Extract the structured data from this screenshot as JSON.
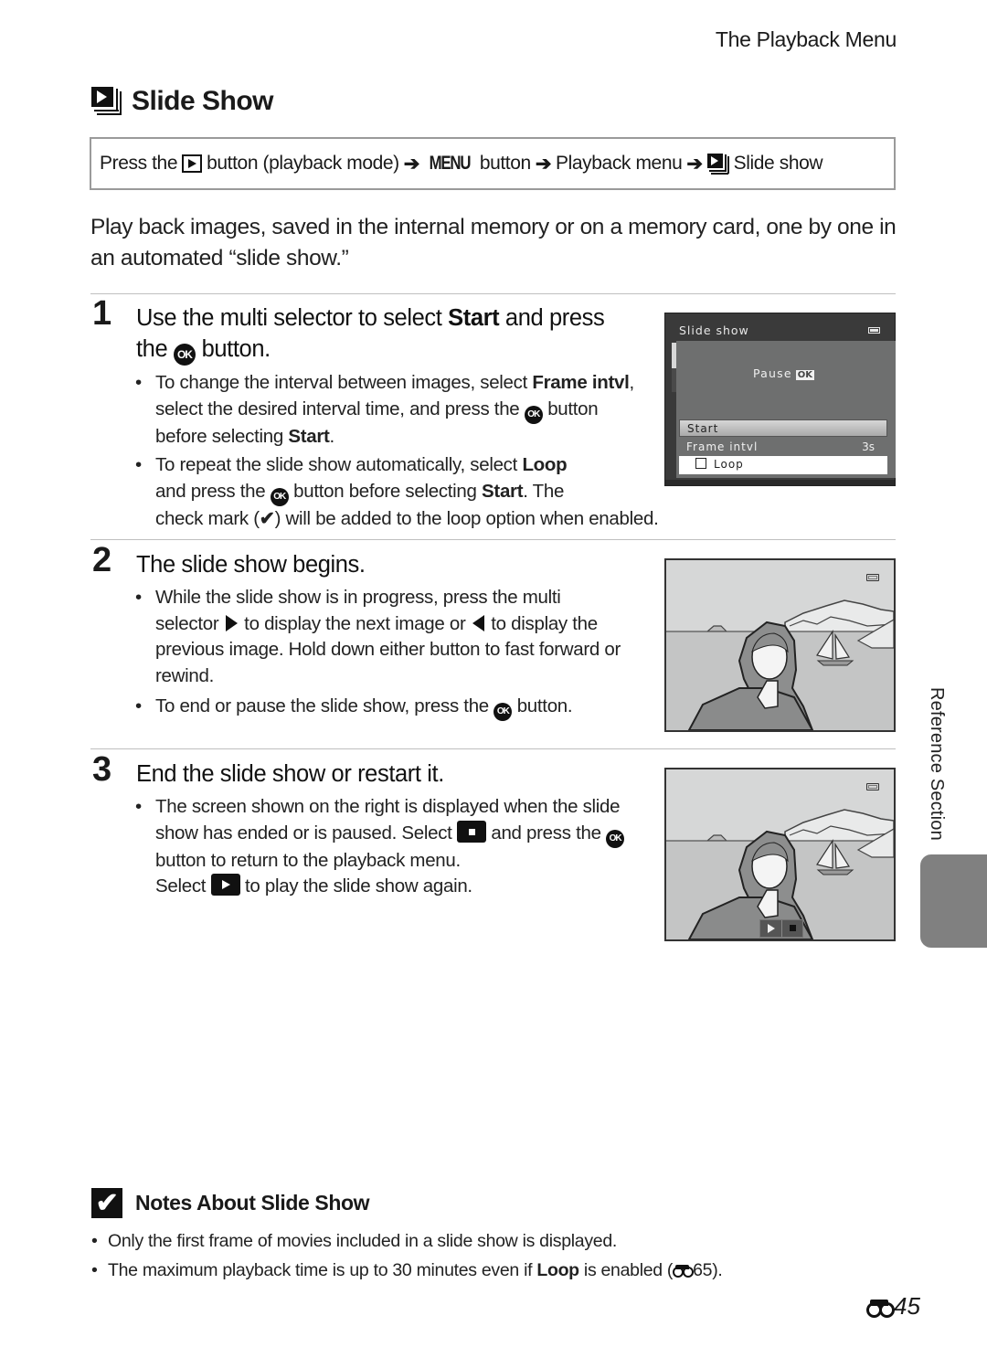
{
  "header": {
    "running_head": "The Playback Menu"
  },
  "title": {
    "icon": "slide-show-icon",
    "text": "Slide Show"
  },
  "nav_path": {
    "press_the": "Press the",
    "play_button_icon": "playback-button-icon",
    "step1": "button (playback mode)",
    "arrow": "➔",
    "menu_label": "MENU",
    "step2": "button",
    "step3": "Playback menu",
    "step4": "Slide show"
  },
  "intro": "Play back images, saved in the internal memory or on a memory card, one by one in an automated “slide show.”",
  "steps": [
    {
      "number": "1",
      "heading_a": "Use the multi selector to select ",
      "heading_bold": "Start",
      "heading_b": " and press the ",
      "heading_c": " button.",
      "bullets": [
        {
          "a": "To change the interval between images, select ",
          "b": "Frame intvl",
          "c": ", select the desired interval time, and press the ",
          "d": " button before selecting ",
          "e": "Start",
          "f": "."
        },
        {
          "a": "To repeat the slide show automatically, select ",
          "b": "Loop",
          "c": " and press the ",
          "d": " button before selecting ",
          "e": "Start",
          "f": ". The check mark (",
          "check": "✔",
          "g": ") will be added to the loop option when enabled."
        }
      ]
    },
    {
      "number": "2",
      "heading": "The slide show begins.",
      "bullets": [
        {
          "a": "While the slide show is in progress, press the multi selector ",
          "b": " to display the next image or ",
          "c": " to display the previous image. Hold down either button to fast forward or rewind."
        },
        {
          "a": "To end or pause the slide show, press the ",
          "b": " button."
        }
      ]
    },
    {
      "number": "3",
      "heading": "End the slide show or restart it.",
      "bullets": [
        {
          "a": "The screen shown on the right is displayed when the slide show has ended or is paused. Select ",
          "b": " and press the ",
          "c": " button to return to the playback menu."
        },
        {
          "a": "Select ",
          "b": " to play the slide show again."
        }
      ]
    }
  ],
  "ok_label": "OK",
  "camera_menu": {
    "title": "Slide show",
    "pause_label": "Pause",
    "ok_label": "OK",
    "items": [
      {
        "label": "Start",
        "selected": true
      },
      {
        "label": "Frame intvl",
        "value": "3s"
      },
      {
        "label": "Loop",
        "checked": false
      }
    ]
  },
  "side_tab": {
    "label": "Reference Section"
  },
  "notes": {
    "heading": "Notes About Slide Show",
    "icon_glyph": "✔",
    "items": [
      {
        "text": "Only the first frame of movies included in a slide show is displayed."
      },
      {
        "a": "The maximum playback time is up to 30 minutes even if ",
        "b": "Loop",
        "c": " is enabled (",
        "ref": "65",
        "d": ")."
      }
    ]
  },
  "page_number": "45"
}
